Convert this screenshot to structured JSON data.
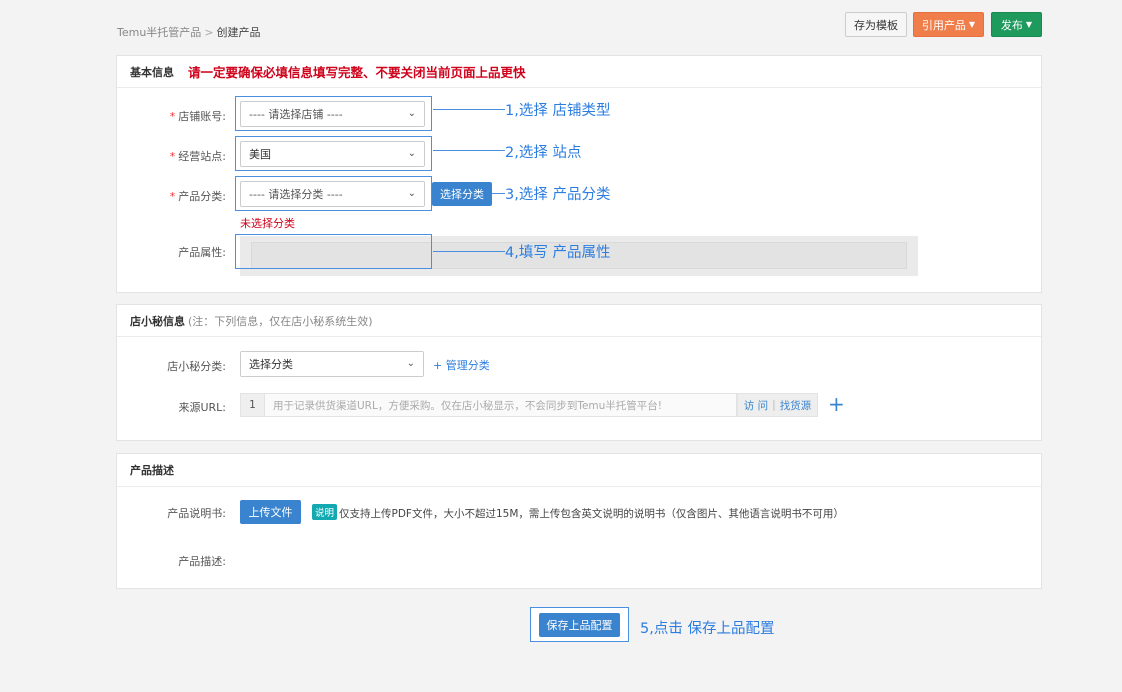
{
  "breadcrumb": {
    "parent": "Temu半托管产品",
    "separator": ">",
    "current": "创建产品"
  },
  "toolbar": {
    "save_template": "存为模板",
    "reference_product": "引用产品",
    "publish": "发布"
  },
  "basic": {
    "title": "基本信息",
    "warning": "请一定要确保必填信息填写完整、不要关闭当前页面上品更快",
    "shop": {
      "label": "店铺账号:",
      "value": "---- 请选择店铺 ----"
    },
    "site": {
      "label": "经营站点:",
      "value": "美国"
    },
    "category": {
      "label": "产品分类:",
      "value": "---- 请选择分类 ----",
      "button": "选择分类",
      "error": "未选择分类"
    },
    "attributes": {
      "label": "产品属性:"
    }
  },
  "annotations": {
    "a1": "1,选择 店铺类型",
    "a2": "2,选择 站点",
    "a3": "3,选择 产品分类",
    "a4": "4,填写 产品属性",
    "a5": "5,点击 保存上品配置"
  },
  "secret": {
    "title": "店小秘信息",
    "note": "(注：下列信息，仅在店小秘系统生效)",
    "category": {
      "label": "店小秘分类:",
      "value": "选择分类",
      "manage": "+ 管理分类"
    },
    "url": {
      "label": "来源URL:",
      "index": "1",
      "placeholder": "用于记录供货渠道URL，方便采购。仅在店小秘显示，不会同步到Temu半托管平台!",
      "visit": "访 问",
      "separator": "|",
      "find": "找货源"
    }
  },
  "desc": {
    "title": "产品描述",
    "manual": {
      "label": "产品说明书:",
      "upload": "上传文件",
      "tag": "说明",
      "hint": "仅支持上传PDF文件，大小不超过15M，需上传包含英文说明的说明书（仅含图片、其他语言说明书不可用）"
    },
    "description": {
      "label": "产品描述:"
    }
  },
  "footer": {
    "save_button": "保存上品配置"
  },
  "colors": {
    "accent": "#3a84cf",
    "annotation": "#2b7de0",
    "warning": "#d0021b",
    "publish": "#1e9a5d",
    "reference": "#f07e4a"
  }
}
